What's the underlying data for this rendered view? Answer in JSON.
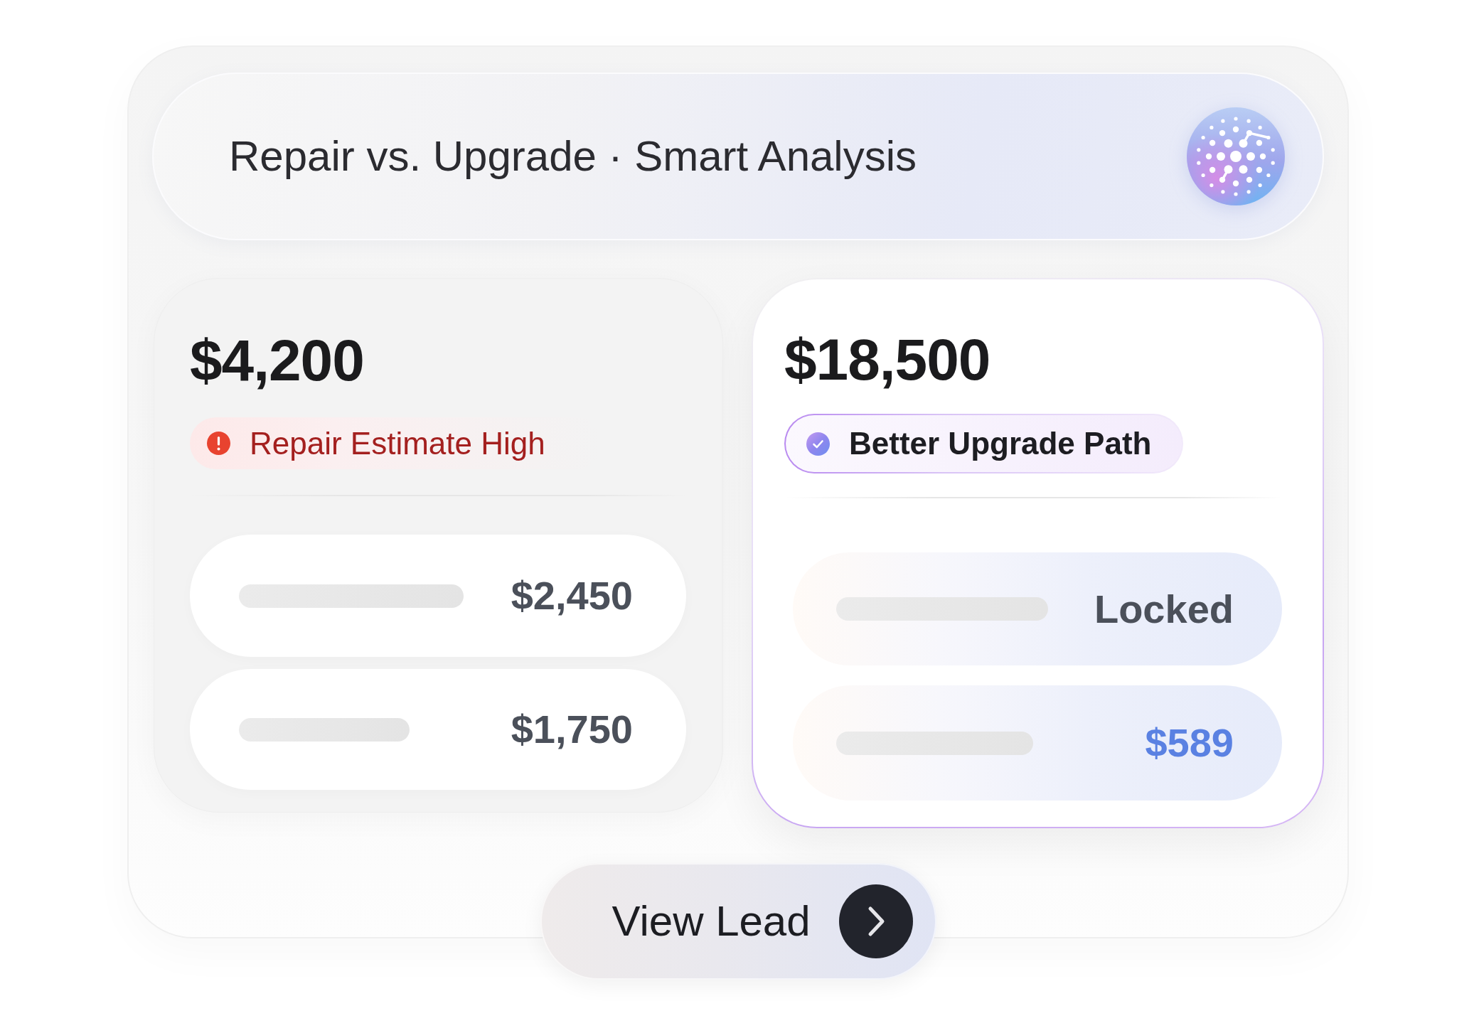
{
  "header": {
    "title": "Repair vs. Upgrade · Smart Analysis"
  },
  "options": [
    {
      "kind": "repair",
      "amount": "$4,200",
      "status": {
        "kind": "alert",
        "text": "Repair Estimate High"
      },
      "items": [
        {
          "value": "$2,450",
          "highlighted": false
        },
        {
          "value": "$1,750",
          "highlighted": false
        }
      ]
    },
    {
      "kind": "upgrade",
      "amount": "$18,500",
      "status": {
        "kind": "recommended",
        "text": "Better Upgrade Path"
      },
      "items": [
        {
          "value": "Locked",
          "highlighted": false
        },
        {
          "value": "$589",
          "highlighted": true
        }
      ]
    }
  ],
  "action": {
    "label": "View Lead"
  }
}
